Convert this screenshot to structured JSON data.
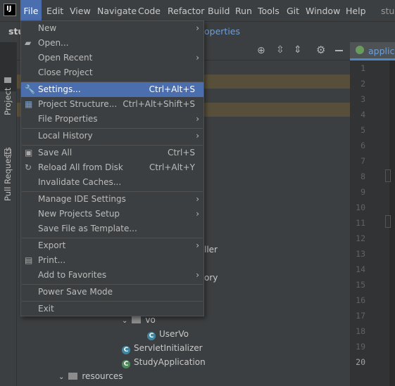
{
  "menubar": {
    "logo": "IJ",
    "items": [
      "File",
      "Edit",
      "View",
      "Navigate",
      "Code",
      "Refactor",
      "Build",
      "Run",
      "Tools",
      "Git",
      "Window",
      "Help"
    ],
    "project_title": "stud"
  },
  "navbar": {
    "project_crumb": "stu",
    "properties_crumb": "operties"
  },
  "side_tabs": {
    "project": "Project",
    "pull_requests": "Pull Requests"
  },
  "editor": {
    "tab_label": "applica",
    "line_numbers": [
      "1",
      "2",
      "3",
      "4",
      "5",
      "6",
      "7",
      "8",
      "9",
      "10",
      "11",
      "12",
      "13",
      "14",
      "15",
      "16",
      "17",
      "18",
      "19",
      "20"
    ],
    "current_line": "20"
  },
  "tree": {
    "partial_controller": "ller",
    "partial_repository": "ory",
    "vo_folder": "vo",
    "uservo": "UserVo",
    "servlet_initializer": "ServletInitializer",
    "study_application": "StudyApplication",
    "resources": "resources"
  },
  "file_menu": {
    "new": "New",
    "open": "Open...",
    "open_recent": "Open Recent",
    "close_project": "Close Project",
    "settings": "Settings...",
    "settings_shortcut": "Ctrl+Alt+S",
    "project_structure": "Project Structure...",
    "project_structure_shortcut": "Ctrl+Alt+Shift+S",
    "file_properties": "File Properties",
    "local_history": "Local History",
    "save_all": "Save All",
    "save_all_shortcut": "Ctrl+S",
    "reload": "Reload All from Disk",
    "reload_shortcut": "Ctrl+Alt+Y",
    "invalidate": "Invalidate Caches...",
    "manage_ide": "Manage IDE Settings",
    "new_projects_setup": "New Projects Setup",
    "save_as_template": "Save File as Template...",
    "export": "Export",
    "print": "Print...",
    "add_to_favorites": "Add to Favorites",
    "power_save": "Power Save Mode",
    "exit": "Exit"
  },
  "colors": {
    "accent": "#4b6eaf",
    "background": "#2b2b2b",
    "panel": "#3c3f41"
  }
}
